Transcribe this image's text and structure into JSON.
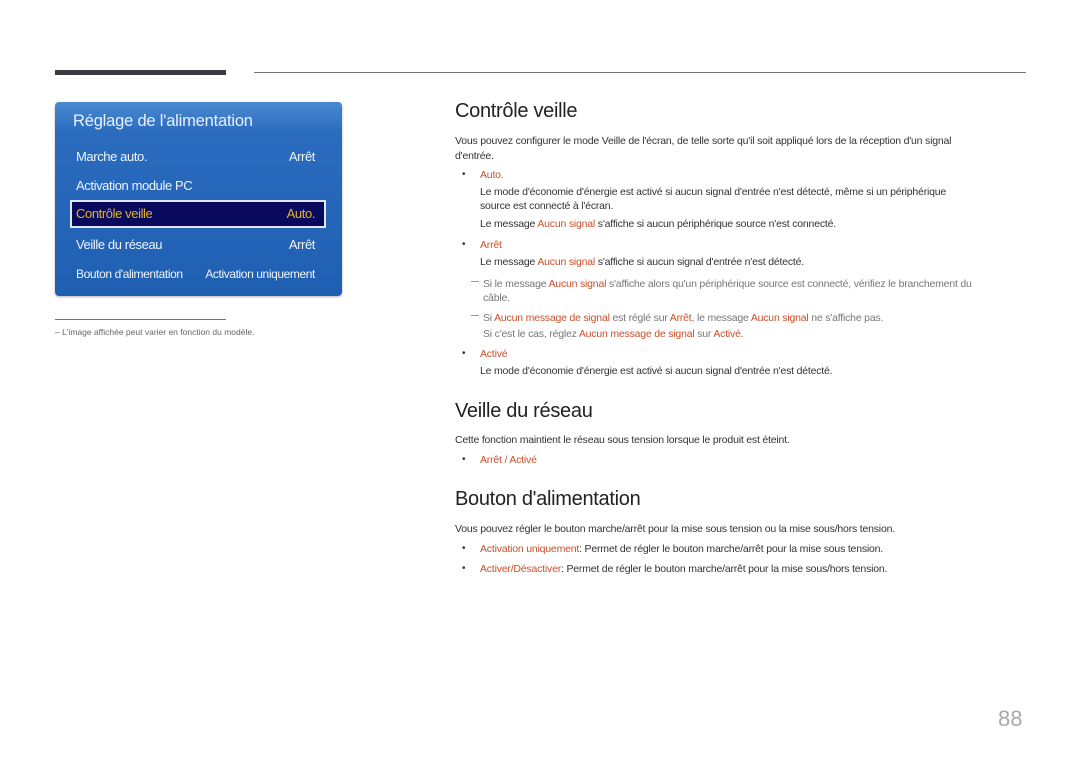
{
  "menu": {
    "title": "Réglage de l'alimentation",
    "items": [
      {
        "label": "Marche auto.",
        "value": "Arrêt"
      },
      {
        "label": "Activation module PC",
        "value": ""
      },
      {
        "label": "Contrôle veille",
        "value": "Auto.",
        "selected": true
      },
      {
        "label": "Veille du réseau",
        "value": "Arrêt"
      },
      {
        "label": "Bouton d'alimentation",
        "value": "Activation uniquement"
      }
    ]
  },
  "footnote": "–  L'image affichée peut varier en fonction du modèle.",
  "sections": {
    "controle_veille": {
      "title": "Contrôle veille",
      "intro_line1": "Vous pouvez configurer le mode Veille de l'écran, de telle sorte qu'il soit appliqué lors de la réception d'un signal",
      "intro_line2": "d'entrée.",
      "auto": {
        "label": "Auto.",
        "desc_line1": "Le mode d'économie d'énergie est activé si aucun signal d'entrée n'est détecté, même si un périphérique",
        "desc_line2": "source est connecté à l'écran.",
        "msg_pre": "Le message ",
        "msg_hl": "Aucun signal",
        "msg_post": " s'affiche si aucun périphérique source n'est connecté."
      },
      "arret": {
        "label": "Arrêt",
        "msg_pre": "Le message ",
        "msg_hl": "Aucun signal",
        "msg_post": " s'affiche si aucun signal d'entrée n'est détecté.",
        "note1_pre": "Si le message ",
        "note1_hl": "Aucun signal",
        "note1_post": " s'affiche alors qu'un périphérique source est connecté, vérifiez le branchement du",
        "note1_line2": "câble.",
        "note2_a": "Si ",
        "note2_b": "Aucun message de signal",
        "note2_c": " est réglé sur ",
        "note2_d": "Arrêt",
        "note2_e": ", le message ",
        "note2_f": "Aucun signal",
        "note2_g": " ne s'affiche pas.",
        "note3_a": "Si c'est le cas, réglez ",
        "note3_b": "Aucun message de signal",
        "note3_c": " sur ",
        "note3_d": "Activé",
        "note3_e": "."
      },
      "active": {
        "label": "Activé",
        "desc": "Le mode d'économie d'énergie est activé si aucun signal d'entrée n'est détecté."
      }
    },
    "veille_reseau": {
      "title": "Veille du réseau",
      "intro": "Cette fonction maintient le réseau sous tension lorsque le produit est éteint.",
      "opt1": "Arrêt",
      "sep": " / ",
      "opt2": "Activé"
    },
    "bouton": {
      "title": "Bouton d'alimentation",
      "intro": "Vous pouvez régler le bouton marche/arrêt pour la mise sous tension ou la mise sous/hors tension.",
      "opt1_label": "Activation uniquement",
      "opt1_desc": ": Permet de régler le bouton marche/arrêt pour la mise sous tension.",
      "opt2_label": "Activer/Désactiver",
      "opt2_desc": ": Permet de régler le bouton marche/arrêt pour la mise sous/hors tension."
    }
  },
  "bullet_char": "•",
  "page_number": "88",
  "colors": {
    "accent": "#c8502a",
    "menu_blue": "#1f5fb2",
    "selected_bg": "#090a5e",
    "selected_text": "#e3b52a"
  }
}
